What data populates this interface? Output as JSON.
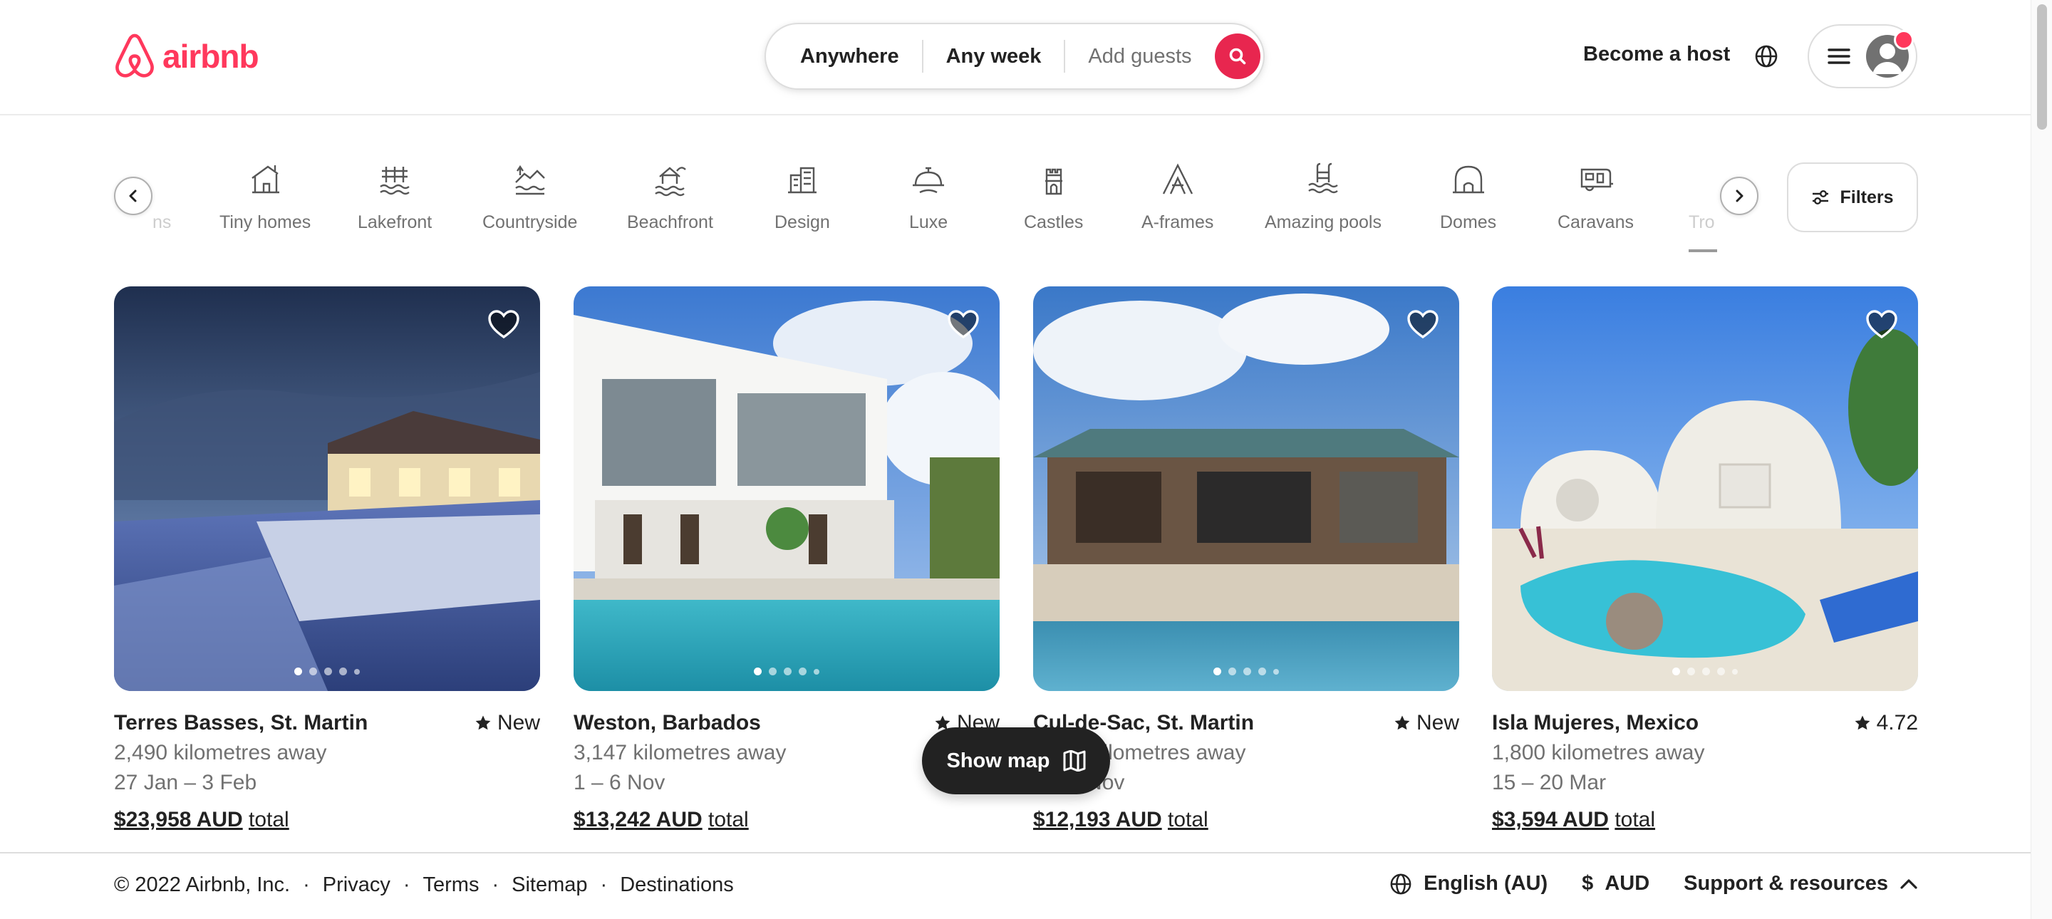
{
  "brand": {
    "name": "airbnb",
    "color": "#ff385c"
  },
  "search": {
    "location": "Anywhere",
    "dates": "Any week",
    "guests_placeholder": "Add guests",
    "button_icon": "search-icon"
  },
  "header": {
    "host_link": "Become a host",
    "globe_icon": "globe-icon",
    "menu_icon": "hamburger-icon"
  },
  "categories": {
    "partial_left": "ns",
    "items": [
      "Tiny homes",
      "Lakefront",
      "Countryside",
      "Beachfront",
      "Design",
      "Luxe",
      "Castles",
      "A-frames",
      "Amazing pools",
      "Domes",
      "Caravans"
    ],
    "partial_right": "Tro",
    "filters_label": "Filters"
  },
  "listings": [
    {
      "location": "Terres Basses, St. Martin",
      "badge": "New",
      "distance": "2,490 kilometres away",
      "dates": "27 Jan – 3 Feb",
      "price": "$23,958 AUD",
      "price_suffix": "total"
    },
    {
      "location": "Weston, Barbados",
      "badge": "New",
      "distance": "3,147 kilometres away",
      "dates": "1 – 6 Nov",
      "price": "$13,242 AUD",
      "price_suffix": "total"
    },
    {
      "location": "Cul-de-Sac, St. Martin",
      "badge": "New",
      "distance": "2,490 kilometres away",
      "dates": "1 – 6 Nov",
      "price": "$12,193 AUD",
      "price_suffix": "total"
    },
    {
      "location": "Isla Mujeres, Mexico",
      "badge": "4.72",
      "distance": "1,800 kilometres away",
      "dates": "15 – 20 Mar",
      "price": "$3,594 AUD",
      "price_suffix": "total"
    }
  ],
  "map_button": {
    "label": "Show map",
    "icon": "map-icon"
  },
  "footer": {
    "copyright": "© 2022 Airbnb, Inc.",
    "links": [
      "Privacy",
      "Terms",
      "Sitemap",
      "Destinations"
    ],
    "language": "English (AU)",
    "currency_symbol": "$",
    "currency": "AUD",
    "support": "Support & resources"
  }
}
